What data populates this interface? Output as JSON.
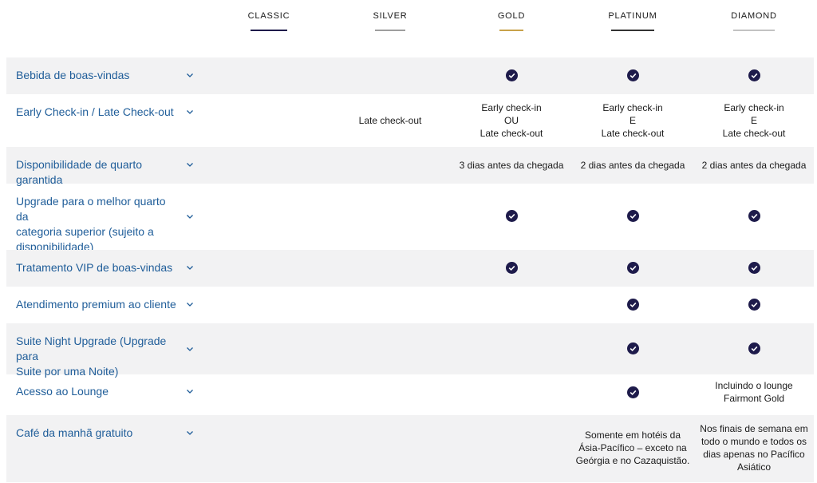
{
  "tiers": [
    {
      "label": "CLASSIC"
    },
    {
      "label": "SILVER"
    },
    {
      "label": "GOLD"
    },
    {
      "label": "PLATINUM"
    },
    {
      "label": "DIAMOND"
    }
  ],
  "rows": [
    {
      "label": "Bebida de boas-vindas",
      "silver": "",
      "gold_check": true,
      "plat_check": true,
      "dia_check": true
    },
    {
      "label": "Early Check-in / Late Check-out",
      "silver": "Late check-out",
      "gold_lines": [
        "Early check-in",
        "OU",
        "Late check-out"
      ],
      "plat_lines": [
        "Early check-in",
        "E",
        "Late check-out"
      ],
      "dia_lines": [
        "Early check-in",
        "E",
        "Late check-out"
      ]
    },
    {
      "label": "Disponibilidade de quarto garantida",
      "gold": "3 dias antes da chegada",
      "plat": "2 dias antes da chegada",
      "dia": "2 dias antes da chegada"
    },
    {
      "label_lines": [
        "Upgrade para o melhor quarto da",
        "categoria superior (sujeito a",
        "disponibilidade)"
      ],
      "gold_check": true,
      "plat_check": true,
      "dia_check": true
    },
    {
      "label": "Tratamento VIP de boas-vindas",
      "gold_check": true,
      "plat_check": true,
      "dia_check": true
    },
    {
      "label": "Atendimento premium ao cliente",
      "plat_check": true,
      "dia_check": true
    },
    {
      "label_lines": [
        "Suite Night Upgrade (Upgrade para",
        "Suite por uma Noite)"
      ],
      "plat_check": true,
      "dia_check": true
    },
    {
      "label": "Acesso ao Lounge",
      "plat_check": true,
      "dia_lines": [
        "Incluindo o lounge",
        "Fairmont Gold"
      ]
    },
    {
      "label": "Café da manhã gratuito",
      "plat_lines": [
        "Somente em hotéis da",
        "Ásia-Pacífico – exceto na",
        "Geórgia e no Cazaquistão."
      ],
      "dia_lines": [
        "Nos finais de semana em",
        "todo o mundo e todos os",
        "dias apenas no Pacífico",
        "Asiático"
      ]
    }
  ],
  "colors": {
    "label_blue": "#1f5d99",
    "check_navy": "#1e1b4b",
    "row_shade": "#f2f2f3",
    "gold_accent": "#c8a24a"
  },
  "icons": {
    "check": "check-circle-icon",
    "expand": "chevron-down-icon"
  }
}
